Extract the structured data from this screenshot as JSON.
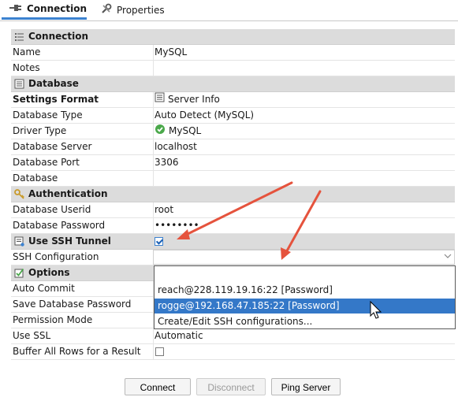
{
  "tabs": [
    {
      "label": "Connection",
      "icon": "plug-icon",
      "active": true
    },
    {
      "label": "Properties",
      "icon": "wrench-icon",
      "active": false
    }
  ],
  "sections": {
    "connection": "Connection",
    "database": "Database",
    "authentication": "Authentication",
    "ssh": "Use SSH Tunnel",
    "options": "Options"
  },
  "fields": {
    "name": {
      "label": "Name",
      "value": "MySQL"
    },
    "notes": {
      "label": "Notes",
      "value": ""
    },
    "settings_format": {
      "label": "Settings Format",
      "value": "Server Info"
    },
    "database_type": {
      "label": "Database Type",
      "value": "Auto Detect (MySQL)"
    },
    "driver_type": {
      "label": "Driver Type",
      "value": "MySQL"
    },
    "database_server": {
      "label": "Database Server",
      "value": "localhost"
    },
    "database_port": {
      "label": "Database Port",
      "value": "3306"
    },
    "database": {
      "label": "Database",
      "value": ""
    },
    "database_userid": {
      "label": "Database Userid",
      "value": "root"
    },
    "database_password": {
      "label": "Database Password",
      "value": "••••••••"
    },
    "ssh_configuration": {
      "label": "SSH Configuration",
      "value": ""
    },
    "auto_commit": {
      "label": "Auto Commit"
    },
    "save_database_password": {
      "label": "Save Database Password"
    },
    "permission_mode": {
      "label": "Permission Mode"
    },
    "use_ssl": {
      "label": "Use SSL",
      "value": "Automatic"
    },
    "buffer_all_rows": {
      "label": "Buffer All Rows for a Result"
    }
  },
  "ssh_tunnel_checked": true,
  "dropdown": {
    "items": [
      "",
      "reach@228.119.19.16:22 [Password]",
      "rogge@192.168.47.185:22 [Password]",
      "Create/Edit SSH configurations..."
    ],
    "selected_index": 2
  },
  "buttons": {
    "connect": "Connect",
    "disconnect": "Disconnect",
    "ping": "Ping Server"
  },
  "colors": {
    "accent": "#3478c8",
    "arrow": "#e5533d",
    "section_bg": "#dcdcdc",
    "driver_ok": "#4aa84a"
  }
}
